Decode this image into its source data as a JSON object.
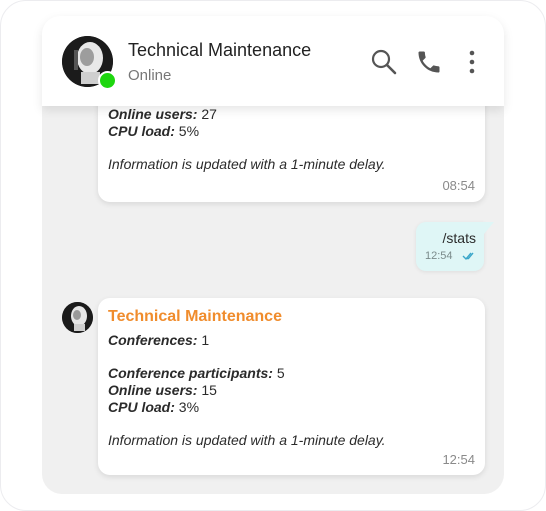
{
  "header": {
    "title": "Technical Maintenance",
    "status": "Online",
    "icons": [
      "search-icon",
      "phone-icon",
      "more-vertical-icon"
    ],
    "accent_online": "#1ed60f"
  },
  "messages": {
    "first": {
      "online_users_label": "Online users:",
      "online_users_value": "27",
      "cpu_load_label": "CPU load:",
      "cpu_load_value": "5%",
      "note": "Information is updated with a 1-minute delay.",
      "time": "08:54"
    },
    "outgoing": {
      "text": "/stats",
      "time": "12:54",
      "status_icon": "double-check-icon"
    },
    "second": {
      "sender": "Technical Maintenance",
      "sender_color": "#f08c2c",
      "conferences_label": "Conferences:",
      "conferences_value": "1",
      "participants_label": "Conference participants:",
      "participants_value": "5",
      "online_users_label": "Online users:",
      "online_users_value": "15",
      "cpu_load_label": "CPU load:",
      "cpu_load_value": "3%",
      "note": "Information is updated with a 1-minute delay.",
      "time": "12:54"
    }
  }
}
